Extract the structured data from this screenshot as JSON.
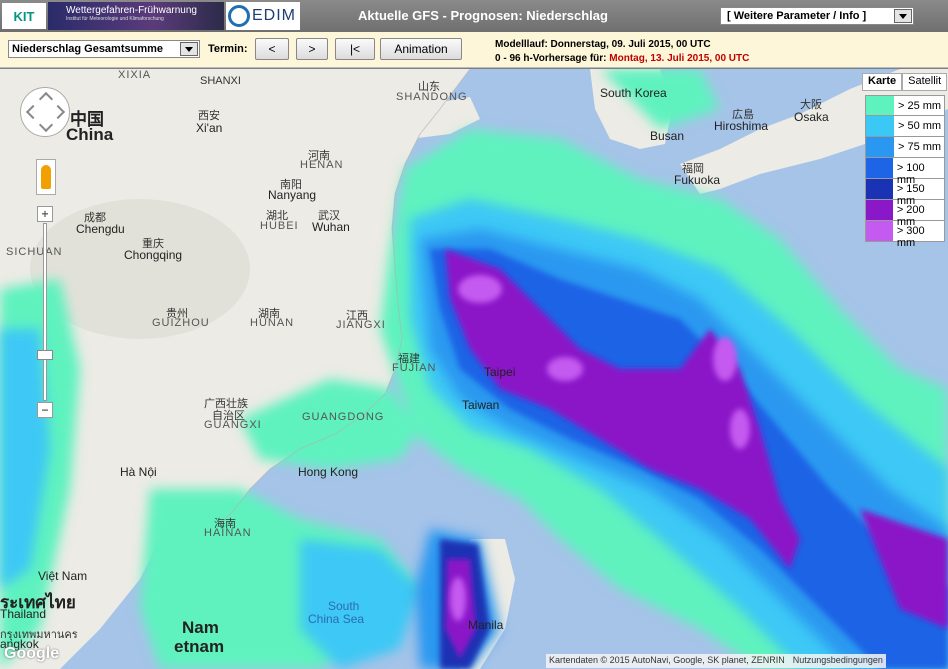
{
  "header": {
    "kit_logo": "KIT",
    "warn_title": "Wettergefahren-Frühwarnung",
    "warn_subtitle": "Institut für Meteorologie und Klimaforschung",
    "edim_logo": "EDIM",
    "page_title": "Aktuelle GFS - Prognosen: Niederschlag",
    "param_select": "[ Weitere Parameter / Info ]"
  },
  "controls": {
    "variable_select": "Niederschlag Gesamtsumme",
    "termin_label": "Termin:",
    "prev_button": "<",
    "next_button": ">",
    "first_button": "|<",
    "animation_button": "Animation",
    "model_run": "Modelllauf: Donnerstag, 09. Juli 2015, 00 UTC",
    "forecast_prefix": "0 - 96 h-Vorhersage für: ",
    "forecast_date": "Montag, 13. Juli 2015, 00 UTC"
  },
  "map_type": {
    "map": "Karte",
    "satellite": "Satellit"
  },
  "legend": [
    {
      "label": "> 25 mm",
      "color": "#5ef2bf"
    },
    {
      "label": "> 50 mm",
      "color": "#3cc8f5"
    },
    {
      "label": "> 75 mm",
      "color": "#2a98f0"
    },
    {
      "label": "> 100 mm",
      "color": "#1e64e6"
    },
    {
      "label": "> 150 mm",
      "color": "#1a32b4"
    },
    {
      "label": "> 200 mm",
      "color": "#8a18c8"
    },
    {
      "label": "> 300 mm",
      "color": "#c45af0"
    }
  ],
  "map_labels": {
    "xixia": "XIXIA",
    "shanxi": "SHANXI",
    "shandong_zh": "山东",
    "shandong": "SHANDONG",
    "zhongguo": "中国",
    "china": "China",
    "xian_zh": "西安",
    "xian": "Xi'an",
    "henan_zh": "河南",
    "henan": "HENAN",
    "nanyang_zh": "南阳",
    "nanyang": "Nanyang",
    "chengdu_zh": "成都",
    "chengdu": "Chengdu",
    "hubei_zh": "湖北",
    "hubei": "HUBEI",
    "wuhan_zh": "武汉",
    "wuhan": "Wuhan",
    "sichuan": "SICHUAN",
    "chongqing_zh": "重庆",
    "chongqing": "Chongqing",
    "guizhou_zh": "贵州",
    "guizhou": "GUIZHOU",
    "hunan_zh": "湖南",
    "hunan": "HUNAN",
    "jiangxi_zh": "江西",
    "jiangxi": "JIANGXI",
    "fujian_zh": "福建",
    "fujian": "FUJIAN",
    "guangxi_zh": "广西壮族",
    "guangxi_zh2": "自治区",
    "guangxi": "GUANGXI",
    "guangdong": "GUANGDONG",
    "hongkong": "Hong Kong",
    "hanoi": "Hà Nội",
    "hainan_zh": "海南",
    "hainan": "HAINAN",
    "korea": "South Korea",
    "busan": "Busan",
    "hiroshima_zh": "広島",
    "hiroshima": "Hiroshima",
    "osaka_zh": "大阪",
    "osaka": "Osaka",
    "fukuoka_zh": "福岡",
    "fukuoka": "Fukuoka",
    "taipei": "Taipei",
    "taiwan": "Taiwan",
    "vietnam": "Việt Nam",
    "thailand_th": "ระเทศไทย",
    "thailand": "Thailand",
    "bangkok_th": "กรุงเทพมหานคร",
    "bangkok": "angkok",
    "namviet": "Nam",
    "etnam": "etnam",
    "manila": "Manila",
    "south_china_sea": "South",
    "south_china_sea2": "China Sea"
  },
  "google_logo": "Google",
  "attribution": "Kartendaten © 2015 AutoNavi, Google, SK planet, ZENRIN",
  "terms": "Nutzungsbedingungen"
}
